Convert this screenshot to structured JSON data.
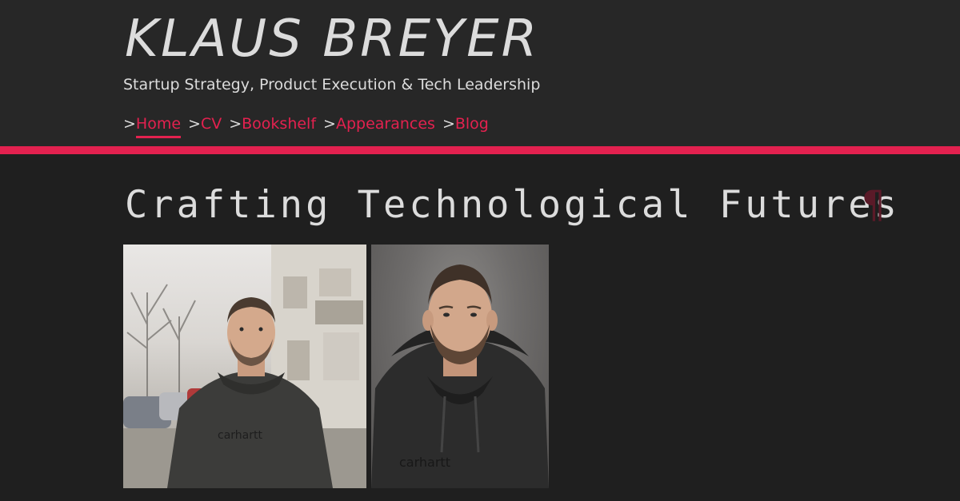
{
  "header": {
    "site_title": "KLAUS BREYER",
    "tagline": "Startup Strategy, Product Execution & Tech Leadership"
  },
  "nav": {
    "prefix": ">",
    "items": [
      {
        "label": "Home",
        "active": true
      },
      {
        "label": "CV",
        "active": false
      },
      {
        "label": "Bookshelf",
        "active": false
      },
      {
        "label": "Appearances",
        "active": false
      },
      {
        "label": "Blog",
        "active": false
      }
    ]
  },
  "main": {
    "heading": "Crafting Technological Futures",
    "anchor_symbol": "¶"
  },
  "photos": [
    {
      "icon": "portrait-photo-street"
    },
    {
      "icon": "portrait-photo-closeup"
    }
  ],
  "colors": {
    "background": "#1f1f1f",
    "header_background": "#272727",
    "accent": "#e3214f",
    "text": "#dcdcdc",
    "anchor": "#5a1a28"
  }
}
